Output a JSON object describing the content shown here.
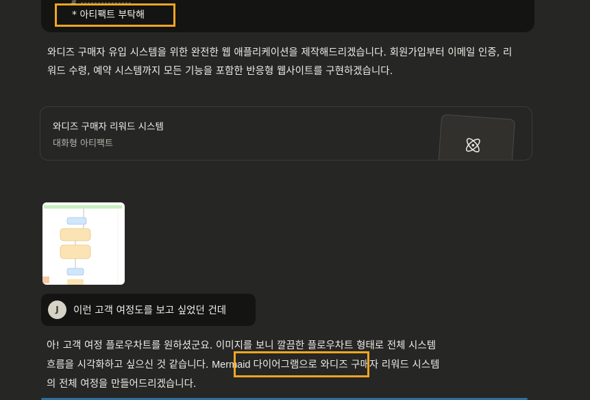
{
  "top_block": {
    "dashes": "# ---------------",
    "label": "* 아티팩트 부탁해"
  },
  "assistant_message_1": "와디즈 구매자 유입 시스템을 위한 완전한 웹 애플리케이션을 제작해드리겠습니다. 회원가입부터 이메일 인증, 리워드 수령, 예약 시스템까지 모든 기능을 포함한 반응형 웹사이트를 구현하겠습니다.",
  "artifact_card": {
    "title": "와디즈 구매자 리워드 시스템",
    "subtitle": "대화형 아티팩트",
    "icon": "atom-icon"
  },
  "user_message": {
    "avatar_initial": "J",
    "text": "이런 고객 여정도를 보고 싶었던 건데"
  },
  "assistant_message_2": {
    "line1": "아! 고객 여정 플로우차트를 원하셨군요. 이미지를 보니 깔끔한 플로우차트 형태로 전체 시스템",
    "line2_pre": "흐름을 시각화하고 싶으신 것 같습니다. ",
    "line2_highlight": "Mermaid 다이어그램으로",
    "line2_post": " 와디즈 구매자 리워드 시스템",
    "line3": "의 전체 여정을 만들어드리겠습니다."
  },
  "colors": {
    "background": "#262624",
    "highlight": "#f5a623",
    "bubble": "#141413"
  }
}
